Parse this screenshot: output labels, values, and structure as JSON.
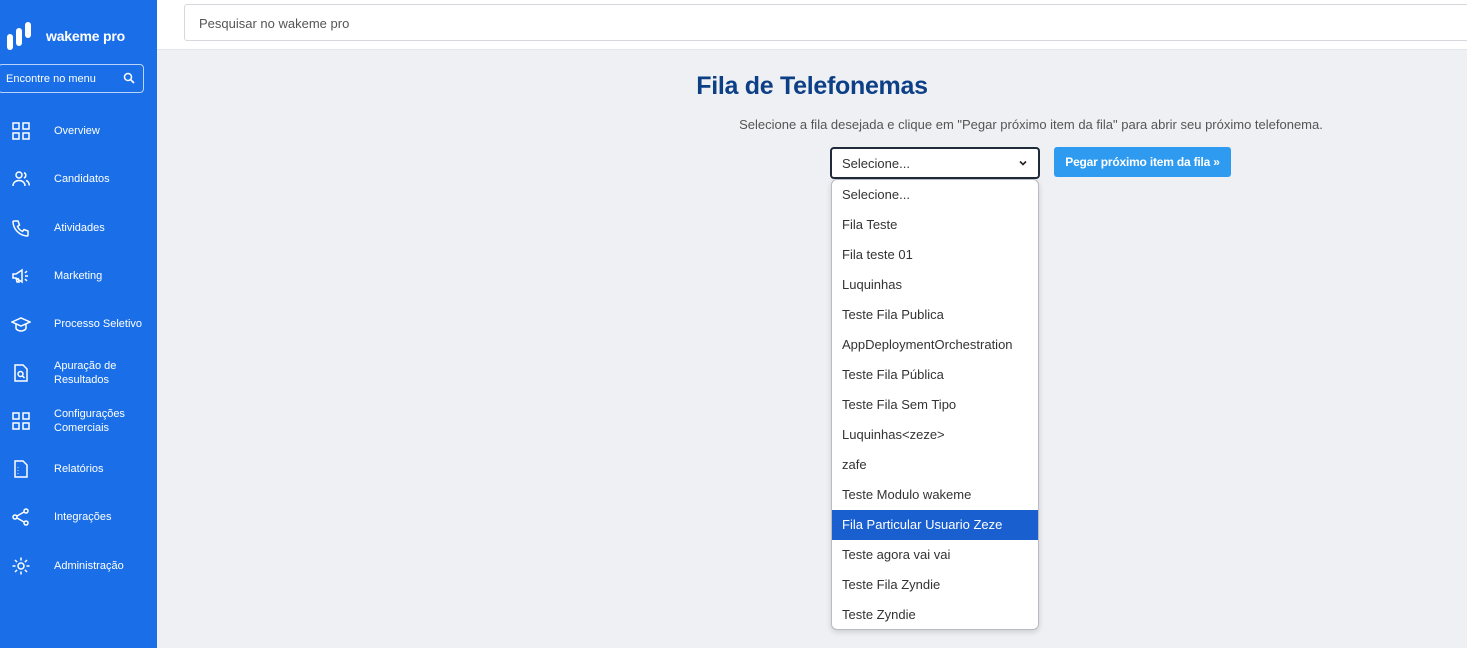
{
  "sidebar": {
    "brand": "wakeme pro",
    "menu_search_label": "Encontre no menu",
    "items": [
      {
        "label": "Overview",
        "icon": "grid-icon"
      },
      {
        "label": "Candidatos",
        "icon": "users-icon"
      },
      {
        "label": "Atividades",
        "icon": "phone-icon"
      },
      {
        "label": "Marketing",
        "icon": "megaphone-icon"
      },
      {
        "label": "Processo Seletivo",
        "icon": "graduation-cap-icon"
      },
      {
        "label": "Apuração de Resultados",
        "icon": "document-search-icon"
      },
      {
        "label": "Configurações Comerciais",
        "icon": "grid-settings-icon"
      },
      {
        "label": "Relatórios",
        "icon": "report-icon"
      },
      {
        "label": "Integrações",
        "icon": "share-icon"
      },
      {
        "label": "Administração",
        "icon": "gear-icon"
      }
    ]
  },
  "topbar": {
    "search_placeholder": "Pesquisar no wakeme pro"
  },
  "main": {
    "title": "Fila de Telefonemas",
    "subtitle": "Selecione a fila desejada e clique em \"Pegar próximo item da fila\" para abrir seu próximo telefonema.",
    "select_value": "Selecione...",
    "next_button": "Pegar próximo item da fila »",
    "options": [
      "Selecione...",
      "Fila Teste",
      "Fila teste 01",
      "Luquinhas",
      "Teste Fila Publica",
      "AppDeploymentOrchestration",
      "Teste Fila Pública",
      "Teste Fila Sem Tipo",
      "Luquinhas<zeze>",
      "zafe",
      "Teste Modulo wakeme",
      "Fila Particular Usuario Zeze",
      "Teste agora vai vai",
      "Teste Fila Zyndie",
      "Teste Zyndie"
    ],
    "highlighted_option": "Fila Particular Usuario Zeze"
  },
  "colors": {
    "sidebar": "#1a6fe8",
    "title": "#0d3f87",
    "button": "#2f9bf0",
    "highlight": "#1a5fd0"
  }
}
